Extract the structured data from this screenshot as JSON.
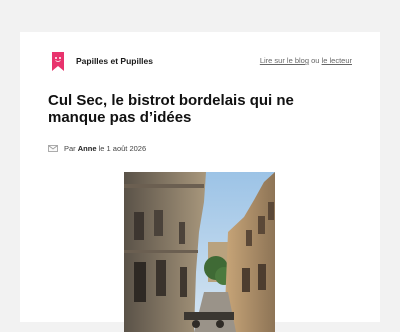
{
  "header": {
    "blog_name": "Papilles et Pupilles",
    "link_blog": "Lire sur le blog",
    "separator": "ou",
    "link_reader": "le lecteur"
  },
  "article": {
    "title": "Cul Sec, le bistrot bordelais qui ne manque pas d’idées",
    "byline_prefix": "Par",
    "author": "Anne",
    "byline_date": "le 1 août 2026"
  },
  "colors": {
    "background": "#f2f2f2",
    "card": "#ffffff",
    "logo": "#e8336d"
  },
  "icons": {
    "logo": "bookmark-logo-icon",
    "byline": "mail-icon"
  }
}
